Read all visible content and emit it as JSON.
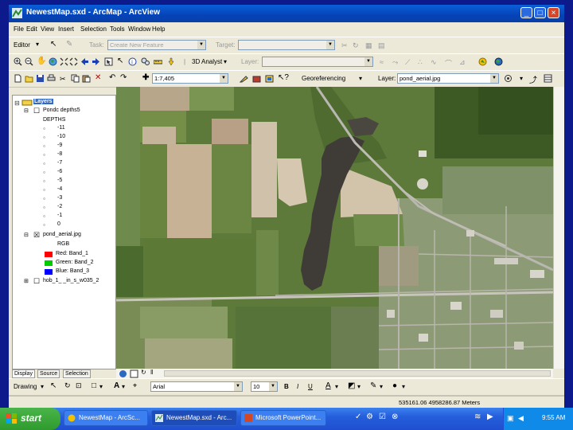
{
  "window": {
    "title": "NewestMap.sxd - ArcMap - ArcView",
    "min": "_",
    "max": "□",
    "close": "×"
  },
  "menu": [
    "File",
    "Edit",
    "View",
    "Insert",
    "Selection",
    "Tools",
    "Window",
    "Help"
  ],
  "editor": {
    "label": "Editor",
    "task_label": "Task:",
    "task_value": "Create New Feature",
    "target_label": "Target:"
  },
  "analyst": {
    "label": "3D Analyst",
    "layer_label": "Layer:"
  },
  "standard": {
    "scale": "1:7,405",
    "georef_label": "Georeferencing",
    "layer_label": "Layer:",
    "layer_value": "pond_aerial.jpg"
  },
  "toc": {
    "root": "Layers",
    "layer1": {
      "name": "Pondc depths5",
      "field": "DEPTHS",
      "values": [
        "-11",
        "-10",
        "-9",
        "-8",
        "-7",
        "-6",
        "-5",
        "-4",
        "-3",
        "-2",
        "-1",
        "0"
      ]
    },
    "layer2": {
      "name": "pond_aerial.jpg",
      "rgb": "RGB",
      "bands": [
        "Red:   Band_1",
        "Green: Band_2",
        "Blue:  Band_3"
      ]
    },
    "layer3": {
      "name": "hob_1_ _in_s_w035_2"
    },
    "tabs": [
      "Display",
      "Source",
      "Selection"
    ]
  },
  "colors": {
    "red_band": "#ff0000",
    "green_band": "#00cc00",
    "blue_band": "#0000ff",
    "title_bar": "#0a5fd8",
    "taskbar": "#245edb",
    "start": "#3c9f3c"
  },
  "drawing": {
    "label": "Drawing",
    "font": "Arial",
    "size": "10"
  },
  "status": {
    "coords": "535161.06  4958286.87 Meters"
  },
  "taskbar": {
    "start": "start",
    "tasks": [
      "NewestMap - ArcSc...",
      "NewestMap.sxd - Arc...",
      "Microsoft PowerPoint..."
    ],
    "clock": "9:55 AM"
  }
}
